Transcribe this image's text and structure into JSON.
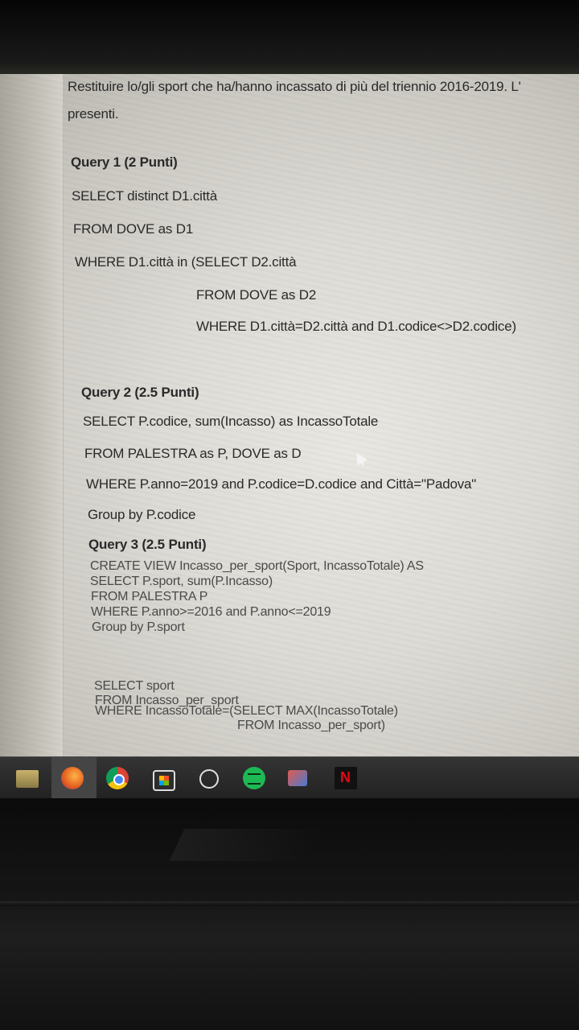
{
  "document": {
    "intro_line1": "Restituire lo/gli sport che ha/hanno incassato di più del triennio 2016-2019. L'",
    "intro_line2": "presenti.",
    "query1": {
      "title": "Query 1 (2 Punti)",
      "lines": [
        "SELECT distinct D1.città",
        "FROM DOVE as D1",
        "WHERE D1.città in (SELECT D2.città",
        "FROM DOVE as D2",
        "WHERE D1.città=D2.città and D1.codice<>D2.codice)"
      ]
    },
    "query2": {
      "title": "Query 2 (2.5 Punti)",
      "lines": [
        "SELECT P.codice, sum(Incasso) as IncassoTotale",
        "FROM PALESTRA as P, DOVE as D",
        "WHERE P.anno=2019 and P.codice=D.codice and Città=\"Padova\"",
        "Group by P.codice"
      ]
    },
    "query3": {
      "title": "Query 3 (2.5 Punti)",
      "view_lines": [
        "CREATE VIEW Incasso_per_sport(Sport, IncassoTotale) AS",
        "SELECT P.sport, sum(P.Incasso)",
        "FROM PALESTRA P",
        "WHERE P.anno>=2016 and P.anno<=2019",
        "Group by P.sport"
      ],
      "select_lines": [
        "SELECT sport",
        "FROM Incasso_per_sport",
        "WHERE IncassoTotale=(SELECT MAX(IncassoTotale)",
        "FROM Incasso_per_sport)"
      ]
    }
  },
  "taskbar": {
    "icons": [
      "folder-icon",
      "firefox-icon",
      "chrome-icon",
      "store-icon",
      "gauge-icon",
      "spotify-icon",
      "people-icon",
      "netflix-icon"
    ]
  }
}
